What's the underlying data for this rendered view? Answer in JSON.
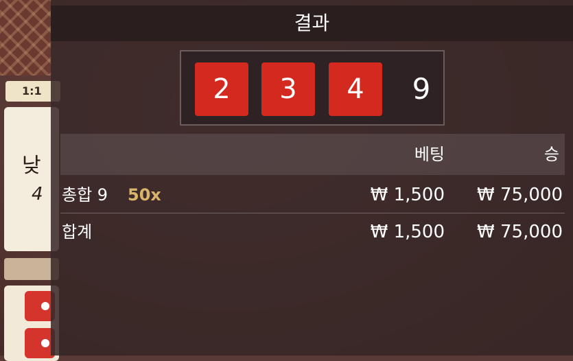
{
  "background": {
    "left_tab_label": "1:1",
    "left_card_text": "낮",
    "left_card_number": "4"
  },
  "title": "결과",
  "dice": [
    "2",
    "3",
    "4"
  ],
  "total": "9",
  "table": {
    "headers": {
      "bet": "베팅",
      "win": "승"
    },
    "rows": [
      {
        "label": "총합 9",
        "multiplier": "50x",
        "bet": "₩ 1,500",
        "win": "₩ 75,000"
      },
      {
        "label": "합계",
        "multiplier": "",
        "bet": "₩ 1,500",
        "win": "₩ 75,000"
      }
    ]
  },
  "colors": {
    "die": "#d4291f",
    "multiplier": "#d9b46a"
  }
}
